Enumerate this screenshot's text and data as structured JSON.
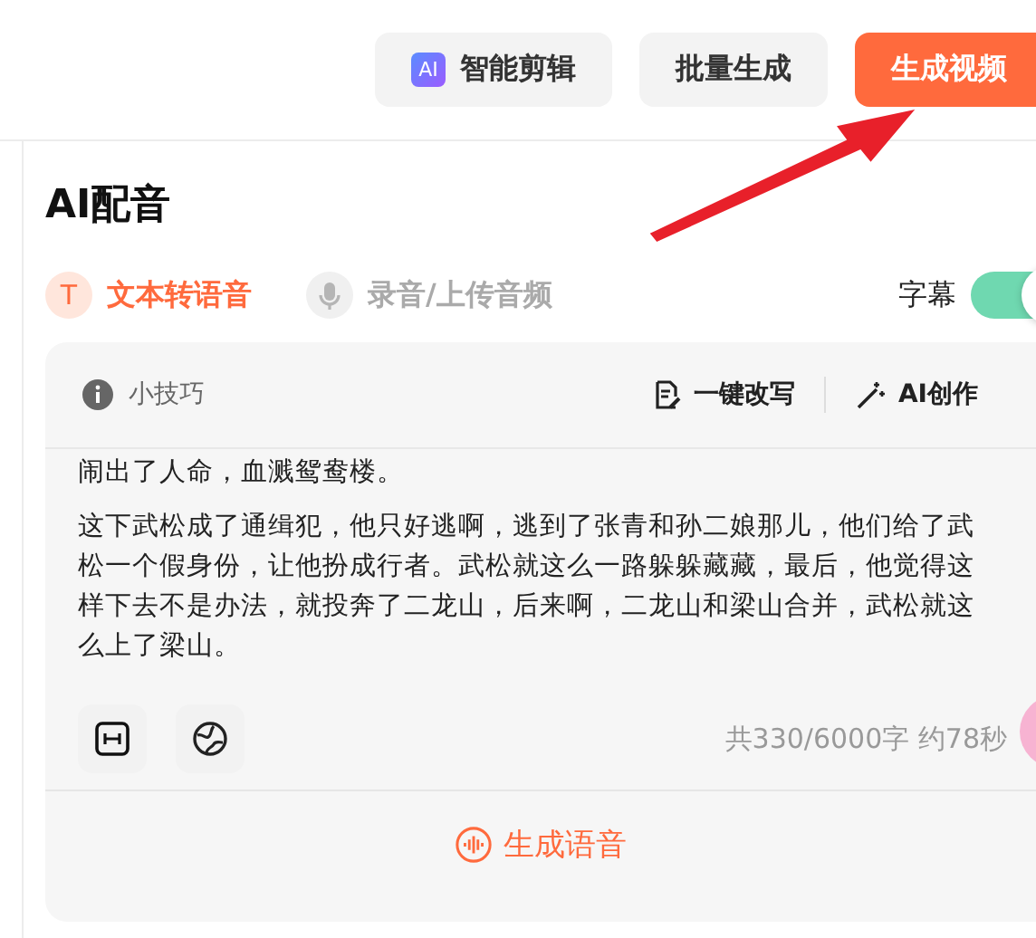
{
  "top_buttons": [
    {
      "kind": "ai",
      "badge": "AI",
      "label": "智能剪辑"
    },
    {
      "kind": "plain",
      "label": "批量生成"
    },
    {
      "kind": "primary",
      "label": "生成视频"
    }
  ],
  "title": "AI配音",
  "mode_tabs": [
    {
      "kind": "text",
      "icon_text": "T",
      "label": "文本转语音",
      "selected": true
    },
    {
      "kind": "mic",
      "label": "录音/上传音频",
      "selected": false
    }
  ],
  "subtitle_toggle": {
    "label": "字幕",
    "on": true
  },
  "editor": {
    "tip": "小技巧",
    "actions": [
      {
        "kind": "rewrite",
        "label": "一键改写"
      },
      {
        "kind": "ai",
        "label": "AI创作"
      }
    ],
    "paragraphs": [
      "闹出了人命，血溅鸳鸯楼。",
      "这下武松成了通缉犯，他只好逃啊，逃到了张青和孙二娘那儿，他们给了武松一个假身份，让他扮成行者。武松就这么一路躲躲藏藏，最后，他觉得这样下去不是办法，就投奔了二龙山，后来啊，二龙山和梁山合并，武松就这么上了梁山。"
    ],
    "tools": [
      {
        "kind": "pause"
      },
      {
        "kind": "globe"
      }
    ],
    "counter": "共330/6000字 约78秒",
    "generate_button": "生成语音"
  }
}
